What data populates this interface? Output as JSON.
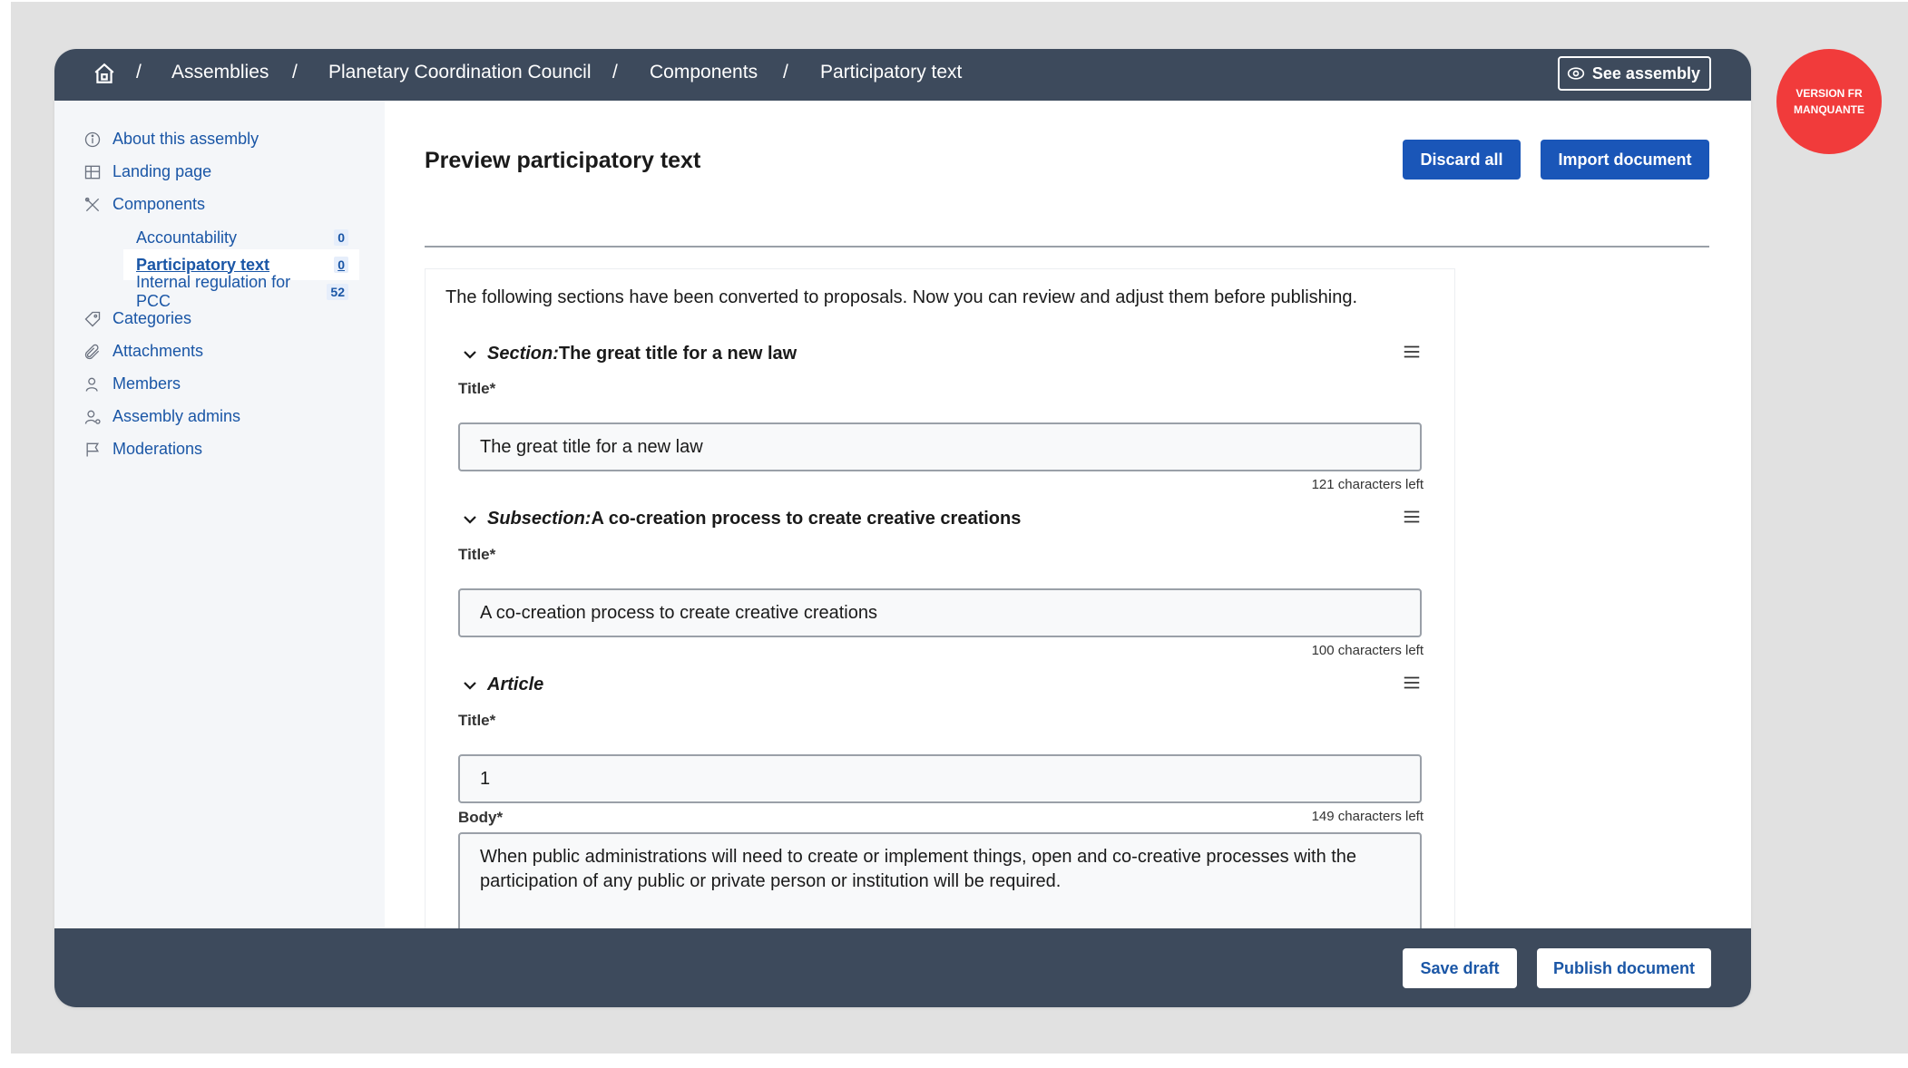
{
  "breadcrumb": {
    "items": [
      "Assemblies",
      "Planetary Coordination Council",
      "Components",
      "Participatory text"
    ],
    "separator": "/"
  },
  "header": {
    "see_assembly_label": "See assembly"
  },
  "sidebar": {
    "items": [
      {
        "label": "About this assembly",
        "icon": "info-icon"
      },
      {
        "label": "Landing page",
        "icon": "layout-icon"
      },
      {
        "label": "Components",
        "icon": "tools-icon"
      },
      {
        "label": "Categories",
        "icon": "tag-icon"
      },
      {
        "label": "Attachments",
        "icon": "paperclip-icon"
      },
      {
        "label": "Members",
        "icon": "user-icon"
      },
      {
        "label": "Assembly admins",
        "icon": "user-admin-icon"
      },
      {
        "label": "Moderations",
        "icon": "flag-icon"
      }
    ],
    "components": [
      {
        "label": "Accountability",
        "count": "0"
      },
      {
        "label": "Participatory text",
        "count": "0"
      },
      {
        "label": "Internal regulation for PCC",
        "count": "52"
      }
    ]
  },
  "main": {
    "title": "Preview participatory text",
    "discard_label": "Discard all",
    "import_label": "Import document",
    "intro": "The following sections have been converted to proposals. Now you can review and adjust them before publishing.",
    "sections": [
      {
        "kind": "Section:",
        "heading": "The great title for a new law",
        "title_label": "Title*",
        "title_value": "The great title for a new law",
        "chars_left": "121 characters left"
      },
      {
        "kind": "Subsection:",
        "heading": "A co-creation process to create creative creations",
        "title_label": "Title*",
        "title_value": "A co-creation process to create creative creations",
        "chars_left": "100 characters left"
      },
      {
        "kind": "Article",
        "heading": "",
        "title_label": "Title*",
        "title_value": "1",
        "body_label": "Body*",
        "body_chars_left": "149 characters left",
        "body_value": "When public administrations will need to create or implement things, open and co-creative processes with the participation of any public or private person or institution will be required."
      }
    ]
  },
  "footer": {
    "save_label": "Save draft",
    "publish_label": "Publish document"
  },
  "badge": {
    "line1": "VERSION FR",
    "line2": "MANQUANTE",
    "color": "#f13b3b"
  },
  "colors": {
    "topbar": "#3d4a5c",
    "primary": "#1a56b8",
    "link": "#1a56a6"
  }
}
